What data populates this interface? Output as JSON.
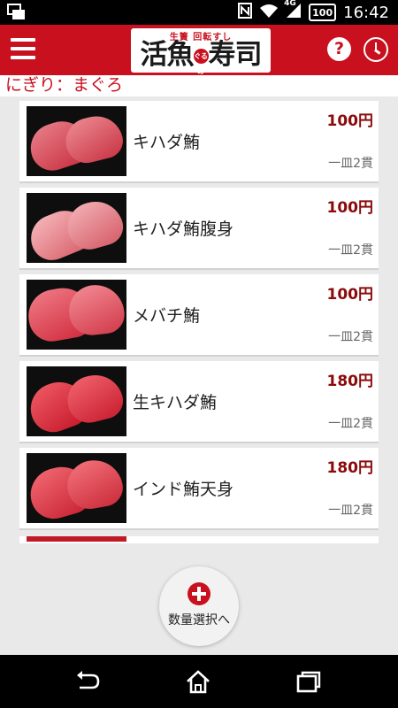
{
  "status_bar": {
    "time": "16:42",
    "network": "4G",
    "battery": "100"
  },
  "header": {
    "logo_sub": "生簀 回転すし",
    "logo_main_1": "活魚",
    "logo_seal": "ぐるめ",
    "logo_main_2": "寿司",
    "help_label": "?"
  },
  "category_label": "にぎり：まぐろ",
  "items": [
    {
      "name": "キハダ鮪",
      "price": "100円",
      "portion": "一皿2貫"
    },
    {
      "name": "キハダ鮪腹身",
      "price": "100円",
      "portion": "一皿2貫"
    },
    {
      "name": "メバチ鮪",
      "price": "100円",
      "portion": "一皿2貫"
    },
    {
      "name": "生キハダ鮪",
      "price": "180円",
      "portion": "一皿2貫"
    },
    {
      "name": "インド鮪天身",
      "price": "180円",
      "portion": "一皿2貫"
    }
  ],
  "qty_button": {
    "label": "数量選択へ"
  },
  "colors": {
    "brand_red": "#c8101e",
    "price_red": "#8b0a0a"
  },
  "icons": [
    "menu-icon",
    "help-icon",
    "clock-icon",
    "back-icon",
    "home-icon",
    "recent-apps-icon"
  ]
}
